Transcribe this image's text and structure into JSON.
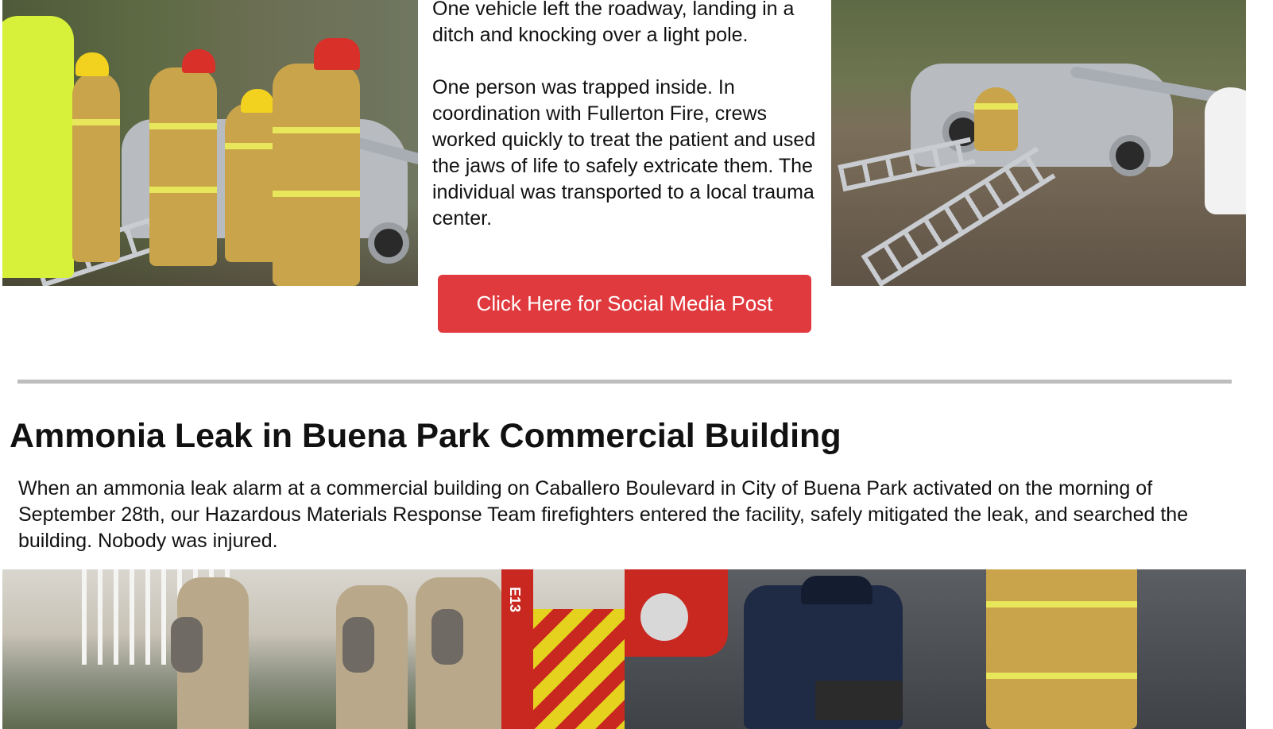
{
  "crash_story": {
    "paragraph_1": "One vehicle left the roadway, landing in a ditch and knocking over a light pole.",
    "paragraph_2": "One person was trapped inside. In coordination with Fullerton Fire, crews worked quickly to treat the patient and used the jaws of life to safely extricate them. The individual was transported to a local trauma center.",
    "social_button_label": "Click Here for Social Media Post"
  },
  "hazmat_story": {
    "heading": "Ammonia Leak in Buena Park Commercial Building",
    "body": "When an ammonia leak alarm at a commercial building on Caballero Boulevard in City of Buena Park activated on the morning of September 28th, our Hazardous Materials Response Team firefighters entered the facility, safely mitigated the leak, and searched the building. Nobody was injured."
  },
  "photos": {
    "engine_label": "E13"
  },
  "colors": {
    "button_red": "#e03a3e",
    "divider_gray": "#bdbdbd",
    "text": "#111111"
  }
}
